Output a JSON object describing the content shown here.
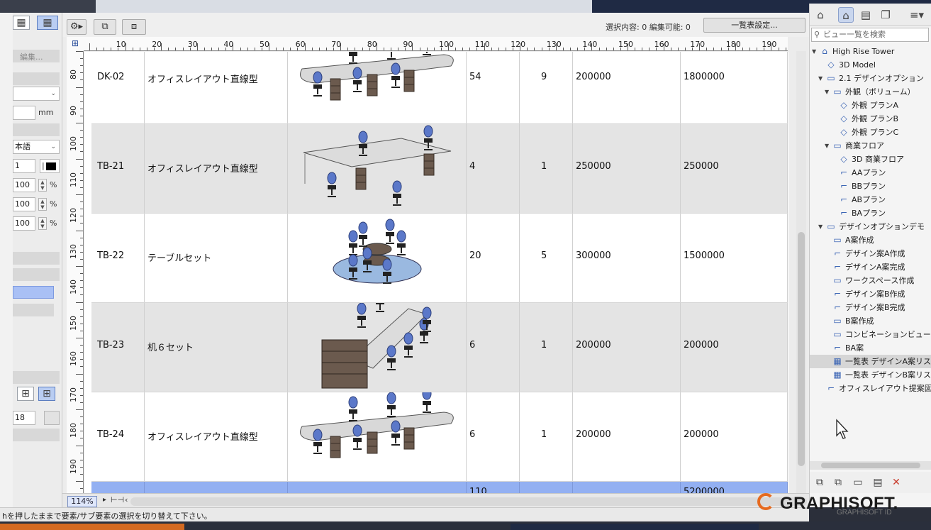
{
  "toolbar": {
    "selection_status": "選択内容: 0  編集可能: 0",
    "schedule_settings_label": "一覧表設定..."
  },
  "info_panel": {
    "edit_label": "編集...",
    "unit": "mm",
    "language": "本語",
    "pen_value": "1",
    "percent_values": [
      "100",
      "100",
      "100"
    ],
    "percent_sign": "%",
    "bottom_value": "18"
  },
  "ruler": {
    "h_labels": [
      "10",
      "20",
      "30",
      "40",
      "50",
      "60",
      "70",
      "80",
      "90",
      "100",
      "110",
      "120",
      "130",
      "140",
      "150",
      "160",
      "170",
      "180",
      "190"
    ],
    "v_labels": [
      "80",
      "90",
      "100",
      "110",
      "120",
      "130",
      "140",
      "150",
      "160",
      "170",
      "180",
      "190"
    ]
  },
  "schedule": {
    "rows": [
      {
        "id": "DK-02",
        "name": "オフィスレイアウト直線型",
        "qty": "54",
        "units": "9",
        "price": "200000",
        "total": "1800000",
        "image": "linear-desk"
      },
      {
        "id": "TB-21",
        "name": "オフィスレイアウト直線型",
        "qty": "4",
        "units": "1",
        "price": "250000",
        "total": "250000",
        "image": "desk-set"
      },
      {
        "id": "TB-22",
        "name": "テーブルセット",
        "qty": "20",
        "units": "5",
        "price": "300000",
        "total": "1500000",
        "image": "round-table"
      },
      {
        "id": "TB-23",
        "name": "机６セット",
        "qty": "6",
        "units": "1",
        "price": "200000",
        "total": "200000",
        "image": "desk-six"
      },
      {
        "id": "TB-24",
        "name": "オフィスレイアウト直線型",
        "qty": "6",
        "units": "1",
        "price": "200000",
        "total": "200000",
        "image": "linear-desk"
      }
    ],
    "totals": {
      "qty": "110",
      "total": "5200000"
    }
  },
  "zoom": "114%",
  "navigator": {
    "search_placeholder": "ビュー一覧を検索",
    "items": [
      {
        "label": "High Rise Tower",
        "level": 0,
        "icon": "building"
      },
      {
        "label": "3D Model",
        "level": 1,
        "icon": "cube"
      },
      {
        "label": "2.1 デザインオプション",
        "level": 1,
        "icon": "folder"
      },
      {
        "label": "外観（ボリューム）",
        "level": 2,
        "icon": "folder"
      },
      {
        "label": "外観 プランA",
        "level": 3,
        "icon": "cube"
      },
      {
        "label": "外観 プランB",
        "level": 3,
        "icon": "cube"
      },
      {
        "label": "外観 プランC",
        "level": 3,
        "icon": "cube"
      },
      {
        "label": "商業フロア",
        "level": 2,
        "icon": "folder"
      },
      {
        "label": "3D 商業フロア",
        "level": 3,
        "icon": "cube"
      },
      {
        "label": "AAプラン",
        "level": 3,
        "icon": "plan"
      },
      {
        "label": "BBプラン",
        "level": 3,
        "icon": "plan"
      },
      {
        "label": "ABプラン",
        "level": 3,
        "icon": "plan"
      },
      {
        "label": "BAプラン",
        "level": 3,
        "icon": "plan"
      },
      {
        "label": "デザインオプションデモ",
        "level": 1,
        "icon": "folder"
      },
      {
        "label": "A案作成",
        "level": 2,
        "icon": "folder"
      },
      {
        "label": "デザイン案A作成",
        "level": 2,
        "icon": "plan"
      },
      {
        "label": "デザインA案完成",
        "level": 2,
        "icon": "plan"
      },
      {
        "label": "ワークスペース作成",
        "level": 2,
        "icon": "folder"
      },
      {
        "label": "デザイン案B作成",
        "level": 2,
        "icon": "plan"
      },
      {
        "label": "デザイン案B完成",
        "level": 2,
        "icon": "plan"
      },
      {
        "label": "B案作成",
        "level": 2,
        "icon": "folder"
      },
      {
        "label": "コンビネーションビュー作成",
        "level": 2,
        "icon": "folder"
      },
      {
        "label": "BA案",
        "level": 2,
        "icon": "plan"
      },
      {
        "label": "一覧表 デザインA案リスト",
        "level": 2,
        "icon": "table",
        "selected": true
      },
      {
        "label": "一覧表 デザインB案リスト",
        "level": 2,
        "icon": "table"
      },
      {
        "label": "オフィスレイアウト提案図面",
        "level": 1,
        "icon": "plan"
      }
    ]
  },
  "status_text": "hを押したままで要素/サブ要素の選択を切り替えて下さい。",
  "brand": {
    "name": "GRAPHISOFT.",
    "sub": "GRAPHISOFT ID"
  },
  "colors": {
    "total_row": "#93b0f2",
    "accent": "#e66a1f",
    "selected_icon": "#b9cdf2"
  }
}
